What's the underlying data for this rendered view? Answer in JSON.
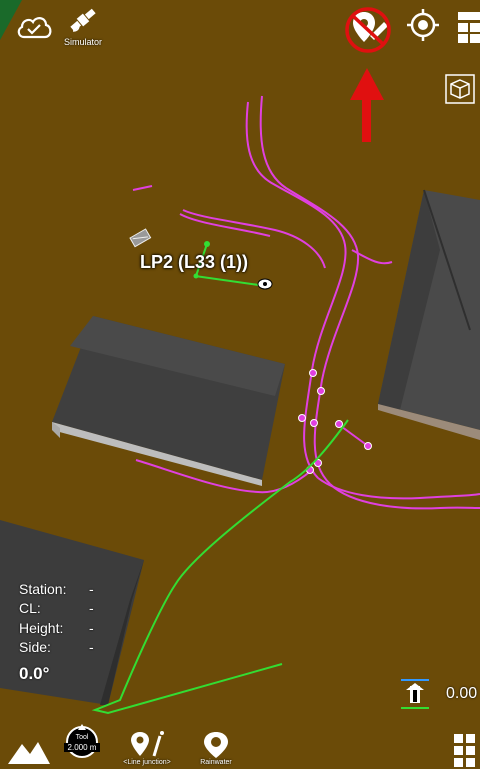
{
  "toolbar": {
    "simulator_label": "Simulator"
  },
  "map": {
    "point_label": "LP2 (L33 (1))"
  },
  "info_panel": {
    "station_label": "Station:",
    "station_value": "-",
    "cl_label": "CL:",
    "cl_value": "-",
    "height_label": "Height:",
    "height_value": "-",
    "side_label": "Side:",
    "side_value": "-",
    "heading_value": "0.0°"
  },
  "elevation": {
    "value": "0.00"
  },
  "bottom_toolbar": {
    "tool_label": "Tool",
    "tool_value": "2.000 m",
    "line_junction_label": "<Line junction>",
    "rainwater_label": "Rainwater"
  },
  "colors": {
    "ground": "#6b4b08",
    "pipe_magenta": "#e040e0",
    "line_green": "#33dd33",
    "alert_red": "#e01010",
    "building_roof": "#3a3a3a"
  },
  "icons": [
    "cloud-check-icon",
    "satellite-icon",
    "no-location-edit-icon",
    "locate-target-icon",
    "layers-icon",
    "cube-view-icon",
    "terrain-icon",
    "rainwater-icon",
    "grid-menu-icon"
  ]
}
